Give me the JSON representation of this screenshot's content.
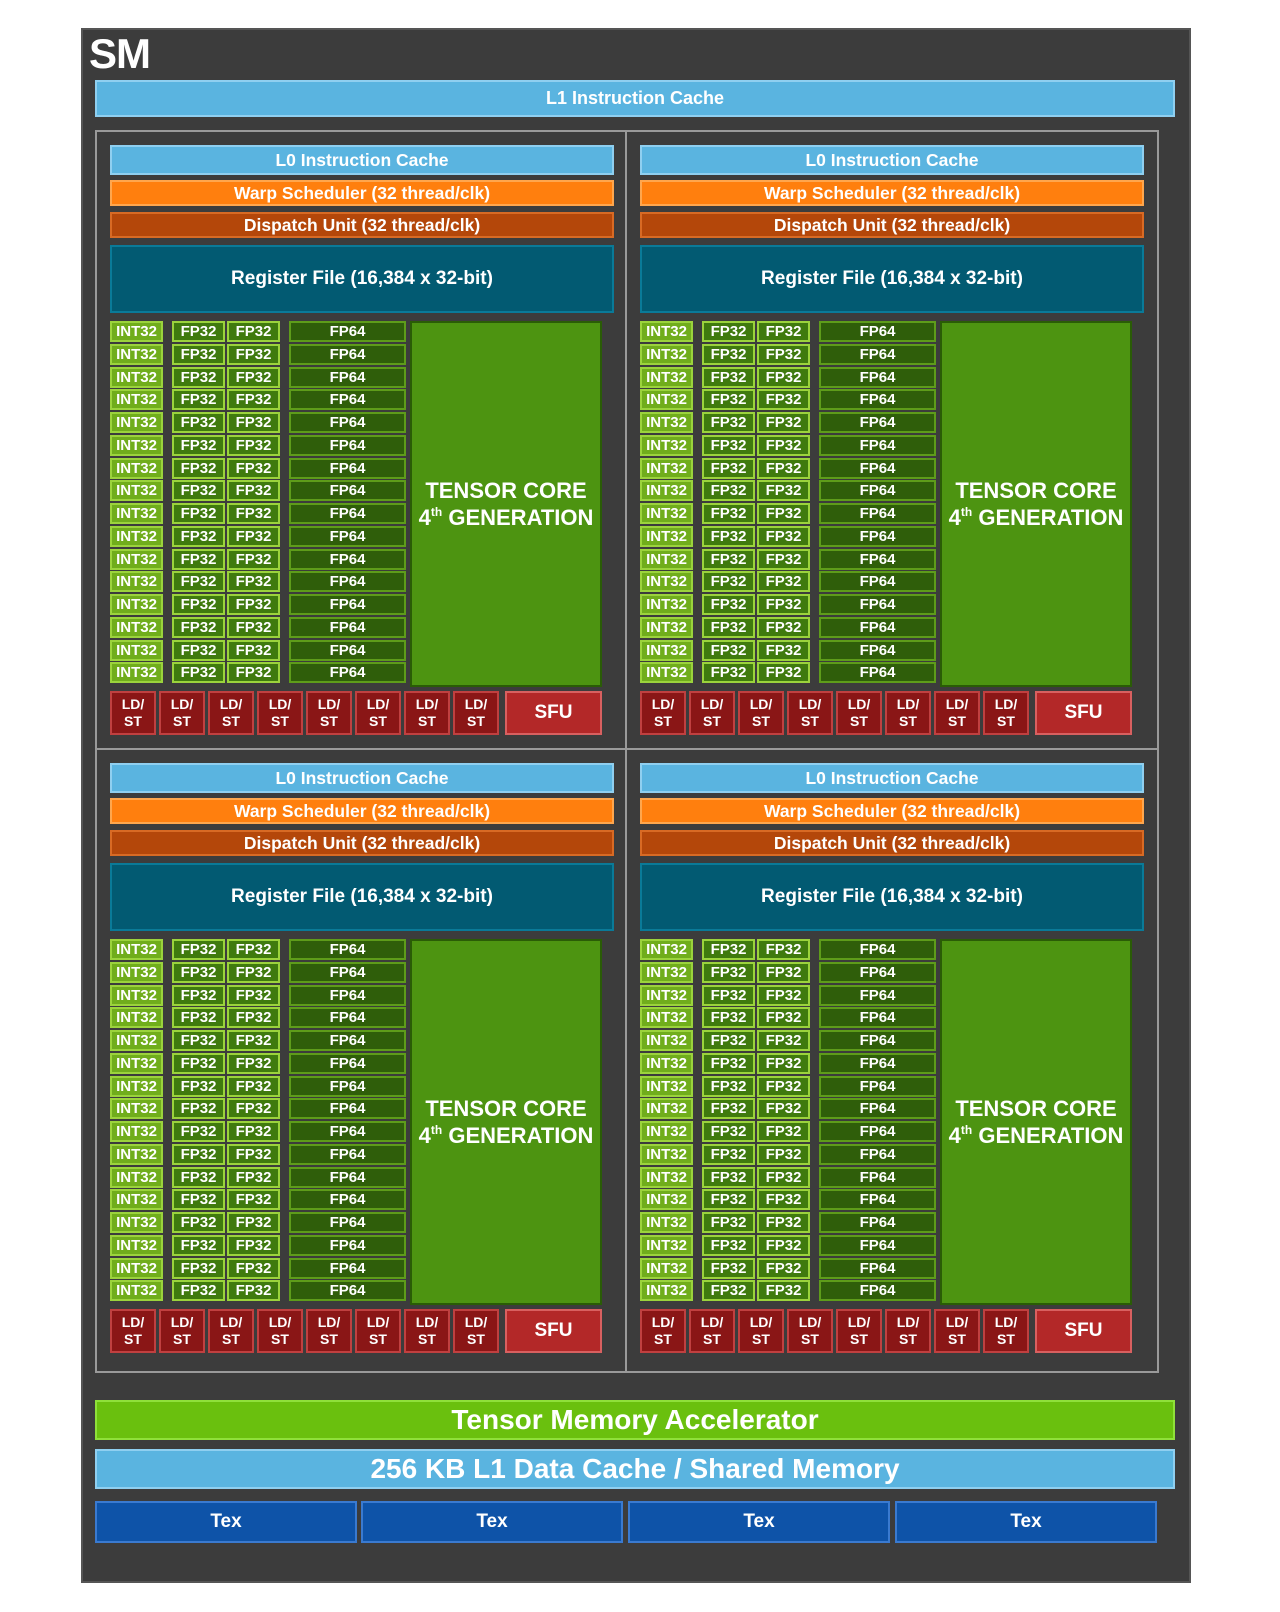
{
  "sm": {
    "title": "SM",
    "l1_instruction_cache": "L1 Instruction Cache",
    "tensor_memory_accelerator": "Tensor Memory Accelerator",
    "l1_data_cache": "256 KB L1 Data Cache / Shared Memory",
    "tex_units": [
      "Tex",
      "Tex",
      "Tex",
      "Tex"
    ]
  },
  "partition": {
    "l0_cache": "L0 Instruction Cache",
    "warp_scheduler": "Warp Scheduler (32 thread/clk)",
    "dispatch_unit": "Dispatch Unit (32 thread/clk)",
    "register_file": "Register File (16,384 x 32-bit)",
    "int32_label": "INT32",
    "fp32_label": "FP32",
    "fp64_label": "FP64",
    "tensor_line1": "TENSOR CORE",
    "tensor_ordinal": "4",
    "tensor_ordinal_suffix": "th",
    "tensor_line2": "GENERATION",
    "ldst_top": "LD/",
    "ldst_bottom": "ST",
    "sfu_label": "SFU",
    "rows_per_partition": 16,
    "ldst_units": 8
  },
  "partition_count": 4,
  "colors": {
    "sm_background": "#3c3c3c",
    "cache_blue": "#5ab4e0",
    "warp_orange": "#ff7f0e",
    "dispatch_brown": "#b4470a",
    "register_teal": "#025a72",
    "int32_green": "#70ad1c",
    "fp32_green": "#3f7a0e",
    "fp64_green": "#2f5e0a",
    "tensor_green": "#4d9411",
    "ldst_red": "#8a1616",
    "sfu_red": "#b32828",
    "tma_green": "#6ac00e",
    "tex_blue": "#0e53a8"
  }
}
